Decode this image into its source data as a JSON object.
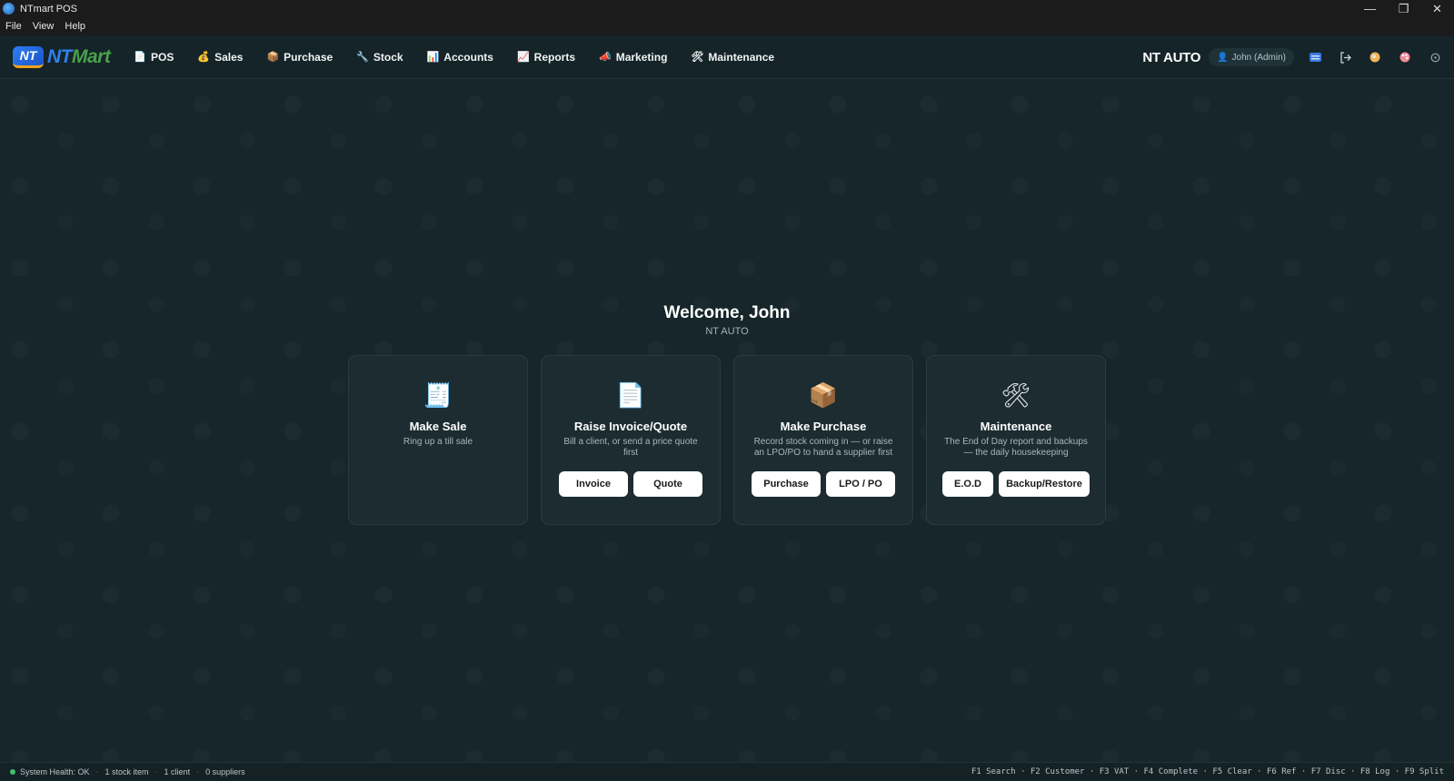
{
  "window": {
    "title": "NTmart POS",
    "controls": {
      "minimize": "—",
      "restore": "❐",
      "close": "✕"
    }
  },
  "menubar": {
    "items": [
      "File",
      "View",
      "Help"
    ]
  },
  "logo": {
    "badge": "NT",
    "name_part1": "NT",
    "name_part2": "Mart"
  },
  "nav": {
    "items": [
      {
        "label": "POS",
        "icon": "📄"
      },
      {
        "label": "Sales",
        "icon": "💰"
      },
      {
        "label": "Purchase",
        "icon": "📦"
      },
      {
        "label": "Stock",
        "icon": "🔧"
      },
      {
        "label": "Accounts",
        "icon": "📊"
      },
      {
        "label": "Reports",
        "icon": "📈"
      },
      {
        "label": "Marketing",
        "icon": "📣"
      },
      {
        "label": "Maintenance",
        "icon": "🛠"
      }
    ],
    "company": "NT AUTO",
    "user": "John (Admin)",
    "right_icons": [
      "keyboard-icon",
      "logout-icon",
      "globe-icon",
      "palette-icon",
      "power-icon"
    ]
  },
  "welcome": {
    "title": "Welcome, John",
    "subtitle": "NT AUTO"
  },
  "cards": [
    {
      "icon": "🧾",
      "title": "Make Sale",
      "desc": "Ring up a till sale",
      "buttons": []
    },
    {
      "icon": "📄",
      "title": "Raise Invoice/Quote",
      "desc": "Bill a client, or send a price quote first",
      "buttons": [
        "Invoice",
        "Quote"
      ]
    },
    {
      "icon": "📦",
      "title": "Make Purchase",
      "desc": "Record stock coming in — or raise an LPO/PO to hand a supplier first",
      "buttons": [
        "Purchase",
        "LPO / PO"
      ]
    },
    {
      "icon": "🛠",
      "title": "Maintenance",
      "desc": "The End of Day report and backups — the daily housekeeping",
      "buttons": [
        "E.O.D",
        "Backup/Restore"
      ]
    }
  ],
  "statusbar": {
    "health": "System Health: OK",
    "stock": "1 stock item",
    "clients": "1 client",
    "suppliers": "0 suppliers",
    "shortcuts": "F1 Search · F2 Customer · F3 VAT · F4 Complete · F5 Clear · F6 Ref · F7 Disc · F8 Log · F9 Split"
  },
  "colors": {
    "background": "#16262b",
    "card": "#1c2c31",
    "health_ok": "#3fc169",
    "logo_blue": "#2f80ed",
    "logo_green": "#48a14a"
  }
}
